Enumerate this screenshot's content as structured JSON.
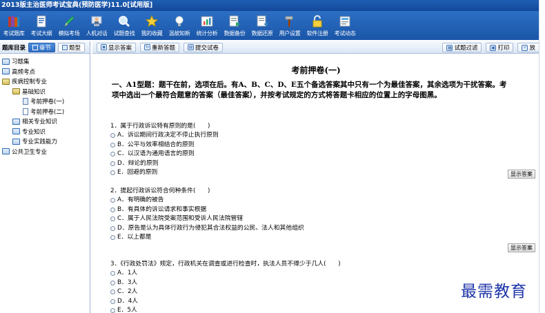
{
  "window": {
    "title": "2013版主治医师考试宝典(预防医学)11.0[试用版]"
  },
  "toolbar": {
    "items": [
      {
        "label": "考试题库",
        "icon": "books-icon"
      },
      {
        "label": "考试大纲",
        "icon": "outline-doc-icon"
      },
      {
        "label": "模拟考场",
        "icon": "pencil-icon"
      },
      {
        "label": "人机对话",
        "icon": "person-dialog-icon"
      },
      {
        "label": "试题查找",
        "icon": "search-icon"
      },
      {
        "label": "我的收藏",
        "icon": "star-icon"
      },
      {
        "label": "温故知新",
        "icon": "lightbulb-icon"
      },
      {
        "label": "统计分析",
        "icon": "bar-chart-icon"
      },
      {
        "label": "数据备份",
        "icon": "backup-icon"
      },
      {
        "label": "数据还原",
        "icon": "restore-icon"
      },
      {
        "label": "用户设置",
        "icon": "hammer-icon"
      },
      {
        "label": "软件注册",
        "icon": "lock-icon"
      },
      {
        "label": "考试动态",
        "icon": "news-icon"
      }
    ]
  },
  "left": {
    "header": "题库目录",
    "tabs": [
      {
        "label": "章节",
        "active": true
      },
      {
        "label": "题型",
        "active": false
      }
    ],
    "tree": [
      {
        "label": "习题集",
        "level": 0,
        "type": "folder",
        "open": false
      },
      {
        "label": "高频考点",
        "level": 0,
        "type": "folder",
        "open": false
      },
      {
        "label": "疾病控制专业",
        "level": 0,
        "type": "folder",
        "open": true
      },
      {
        "label": "基础知识",
        "level": 1,
        "type": "folder",
        "open": true
      },
      {
        "label": "考前押卷(一)",
        "level": 2,
        "type": "doc",
        "selected": true
      },
      {
        "label": "考前押卷(二)",
        "level": 2,
        "type": "doc",
        "selected": false
      },
      {
        "label": "相关专业知识",
        "level": 1,
        "type": "folder",
        "open": false
      },
      {
        "label": "专业知识",
        "level": 1,
        "type": "folder",
        "open": false
      },
      {
        "label": "专业实践能力",
        "level": 1,
        "type": "folder",
        "open": false
      },
      {
        "label": "公共卫生专业",
        "level": 0,
        "type": "folder",
        "open": false
      }
    ]
  },
  "main": {
    "toolbar": {
      "show_answer": "显示答案",
      "reanswer": "重新答题",
      "submit": "提交试卷",
      "filter": "试题过滤",
      "print": "打印",
      "zoom": "放"
    },
    "paper_title": "考前押卷(一)",
    "intro_line1": "一、A1型题：题干在前，选项在后。有A、B、C、D、E五个备选答案其中只有一个为最佳答案，其余选项为干扰答案。考",
    "intro_line2": "项中选出一个最符合题意的答案（最佳答案），并按考试规定的方式将答题卡相应的位置上的字母图黑。",
    "show_answer_label": "显示答案",
    "questions": [
      {
        "stem": "1．属于行政诉讼特有原则的是(　　)",
        "options": [
          "A．诉讼期间行政决定不停止执行原则",
          "B．公平与效率相结合的原则",
          "C．以汉语为通用语言的原则",
          "D．辩论的原则",
          "E．回避的原则"
        ]
      },
      {
        "stem": "2．提起行政诉讼符合何种条件(　　)",
        "options": [
          "A．有明确的被告",
          "B．有具体的诉讼请求和事实根据",
          "C．属于人民法院受案范围和受诉人民法院管辖",
          "D．原告是认为具体行政行为侵犯其合法权益的公民、法人和其他组织",
          "E．以上都是"
        ]
      },
      {
        "stem": "3．《行政处罚法》规定，行政机关在调查或进行检查时，执法人员不得少于几人(　　)",
        "options": [
          "A．1人",
          "B．3人",
          "C．2人",
          "D．4人",
          "E．5人"
        ]
      }
    ]
  },
  "watermark": {
    "text": "最需教育"
  },
  "colors": {
    "titlebar": "#1d5fb3",
    "toolbar": "#2c6fc4",
    "accent": "#2f6cc2",
    "watermark": "#1e35a8"
  }
}
